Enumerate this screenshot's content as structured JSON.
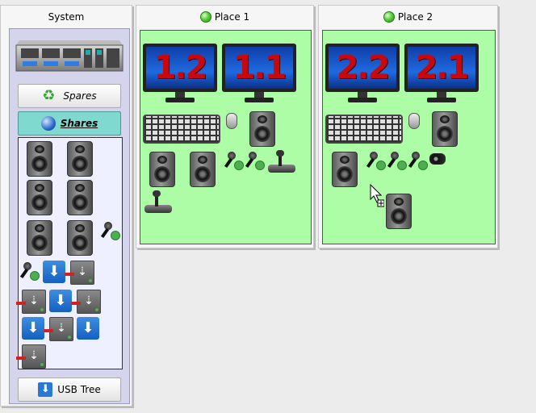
{
  "system": {
    "title": "System",
    "spares_label": "Spares",
    "shares_label": "Shares",
    "usb_tree_label": "USB Tree"
  },
  "places": [
    {
      "title": "Place 1",
      "monitors": [
        "1.2",
        "1.1"
      ]
    },
    {
      "title": "Place 2",
      "monitors": [
        "2.2",
        "2.1"
      ]
    }
  ],
  "icons": {
    "usb": "usb-icon",
    "spares": "recycle-icon",
    "shares": "globe-icon",
    "status": "green-led-icon"
  }
}
